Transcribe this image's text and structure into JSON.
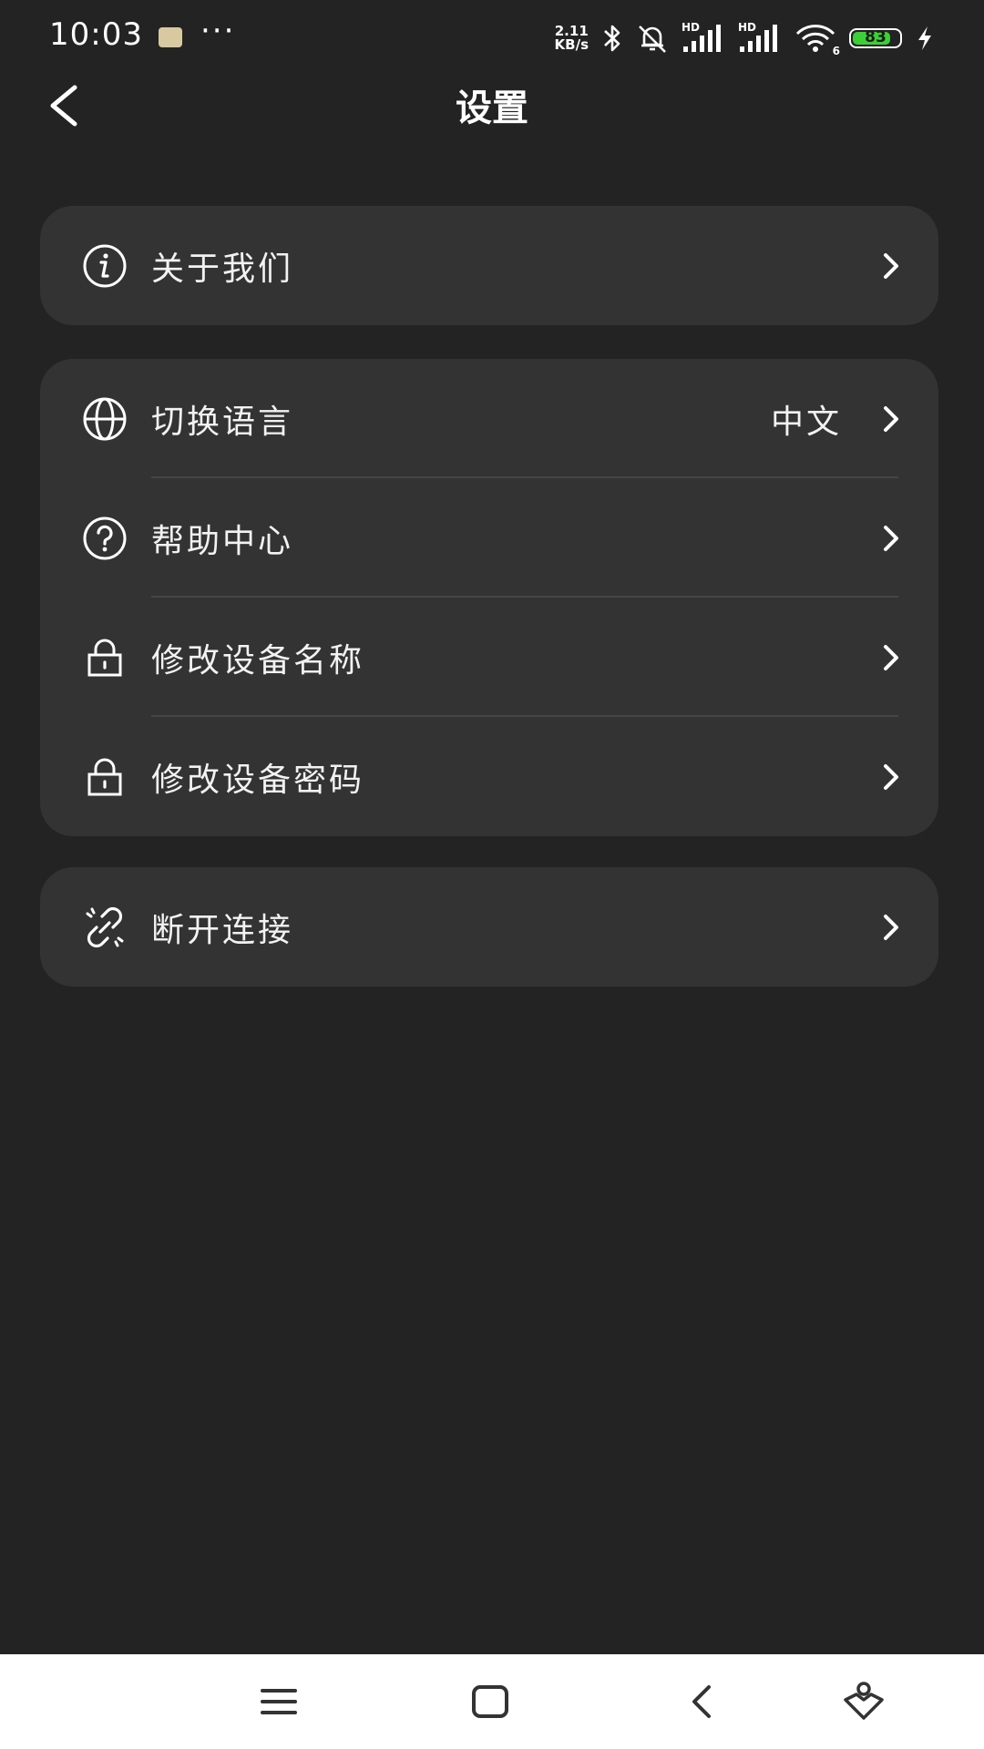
{
  "status_bar": {
    "time": "10:03",
    "dots": "···",
    "net_speed_top": "2.11",
    "net_speed_bottom": "KB/s",
    "hd1": "HD",
    "hd2": "HD",
    "wifi_badge": "6",
    "battery": "83",
    "battery_level": 0.83,
    "battery_color": "#3ccf37"
  },
  "header": {
    "title": "设置"
  },
  "sections": [
    {
      "items": [
        {
          "label": "关于我们",
          "icon": "info-icon"
        }
      ]
    },
    {
      "items": [
        {
          "label": "切换语言",
          "value": "中文",
          "icon": "globe-icon"
        },
        {
          "label": "帮助中心",
          "icon": "help-icon"
        },
        {
          "label": "修改设备名称",
          "icon": "lock-icon"
        },
        {
          "label": "修改设备密码",
          "icon": "lock-icon"
        }
      ]
    },
    {
      "items": [
        {
          "label": "断开连接",
          "icon": "unlink-icon"
        }
      ]
    }
  ],
  "navbar": {
    "buttons": [
      "menu-icon",
      "home-icon",
      "back-icon",
      "assistant-icon"
    ]
  },
  "colors": {
    "background": "#232323",
    "card": "#333333",
    "divider": "#454545",
    "text": "#ffffff"
  }
}
